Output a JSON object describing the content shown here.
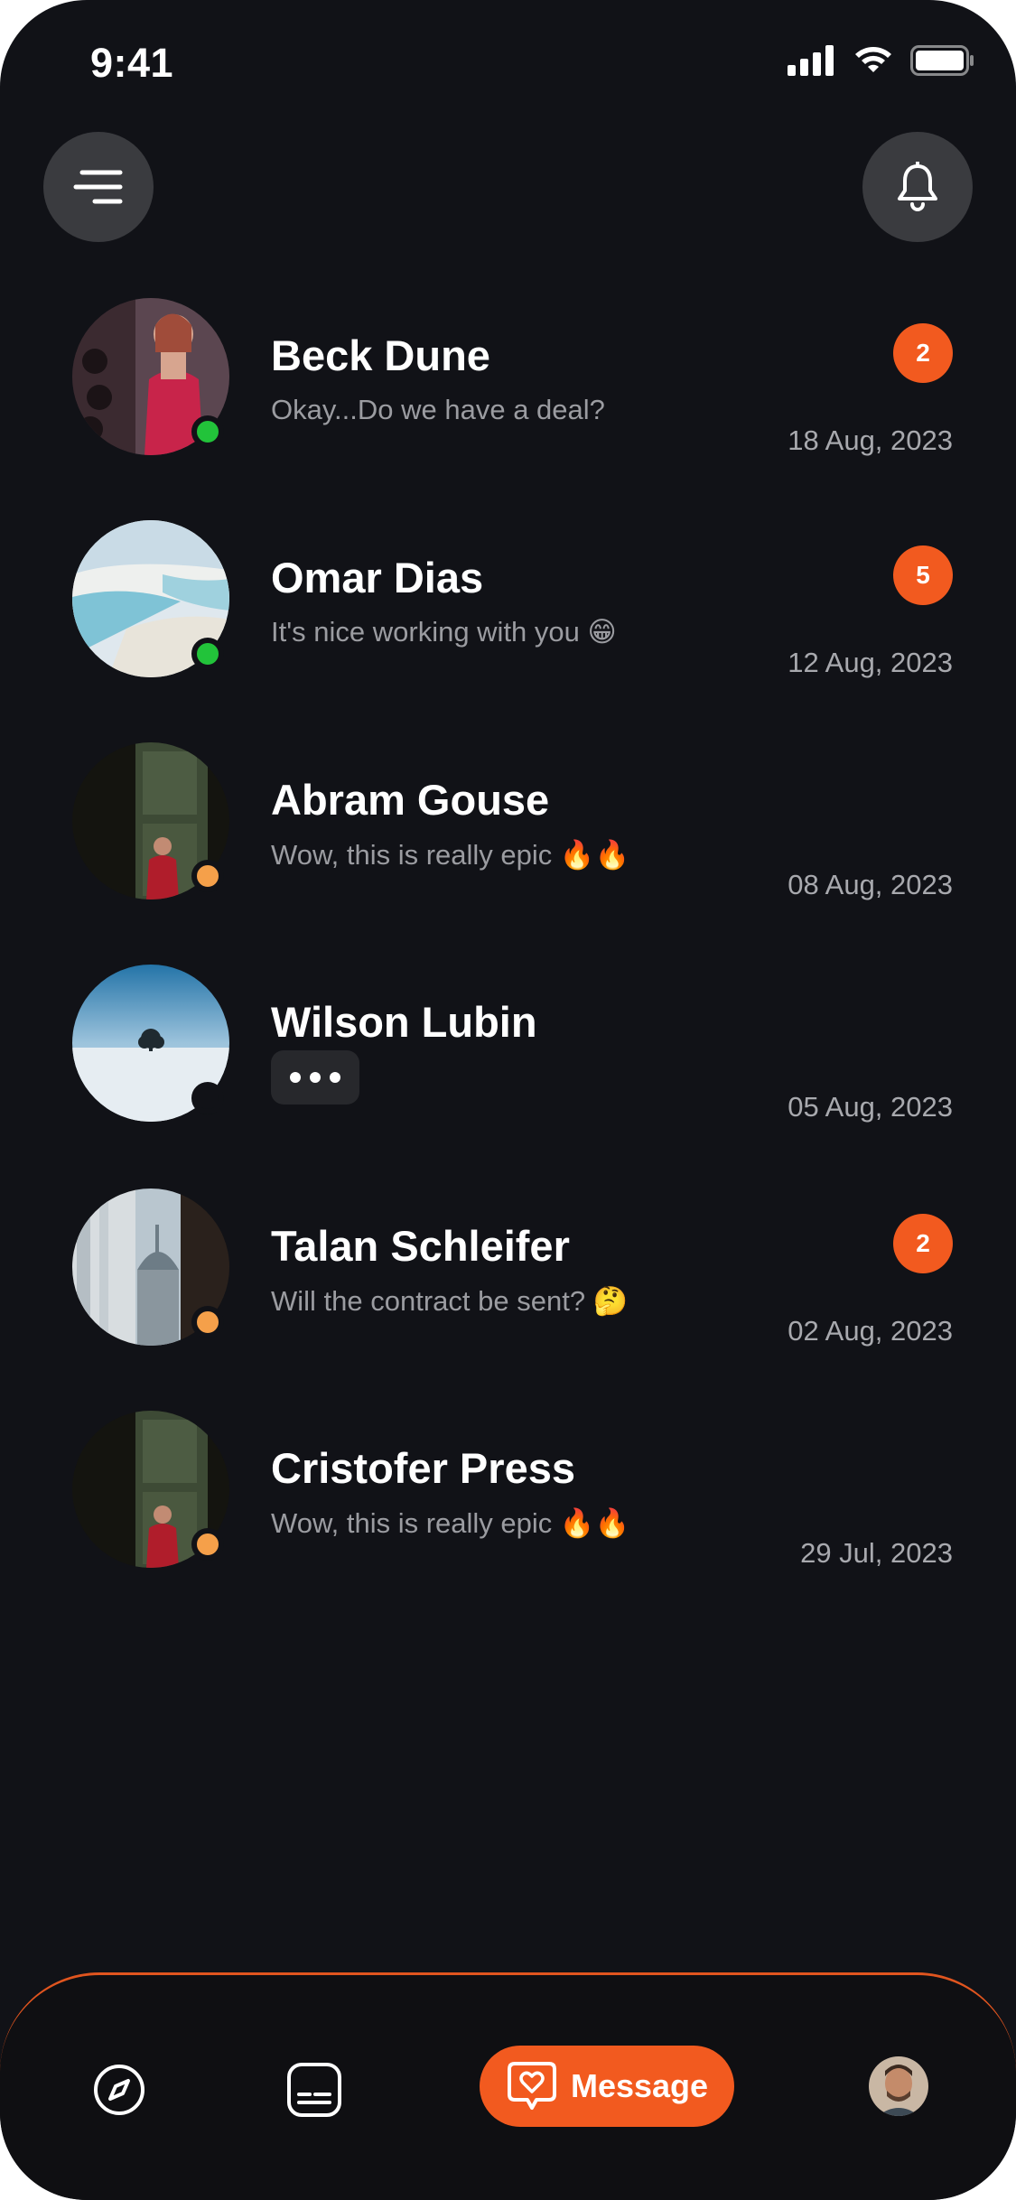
{
  "status_bar": {
    "time": "9:41"
  },
  "header": {
    "menu_icon": "menu-icon",
    "bell_icon": "bell-icon"
  },
  "chats": [
    {
      "name": "Beck Dune",
      "preview": "Okay...Do we have a deal?",
      "date": "18 Aug, 2023",
      "badge": "2",
      "status": "online"
    },
    {
      "name": "Omar Dias",
      "preview": "It's nice working with you 😁",
      "date": "12 Aug, 2023",
      "badge": "5",
      "status": "online"
    },
    {
      "name": "Abram Gouse",
      "preview": "Wow, this is really epic 🔥🔥",
      "date": "08 Aug, 2023",
      "badge": "",
      "status": "away"
    },
    {
      "name": "Wilson Lubin",
      "preview": "",
      "date": "05 Aug, 2023",
      "badge": "",
      "status": "typing"
    },
    {
      "name": "Talan Schleifer",
      "preview": "Will the contract be sent? 🤔",
      "date": "02 Aug, 2023",
      "badge": "2",
      "status": "away"
    },
    {
      "name": "Cristofer Press",
      "preview": "Wow, this is really epic 🔥🔥",
      "date": "29 Jul, 2023",
      "badge": "",
      "status": "away"
    }
  ],
  "nav": {
    "message_label": "Message"
  },
  "colors": {
    "background": "#111217",
    "accent": "#f25a1f",
    "online": "#22c33a",
    "away": "#f5a04a"
  }
}
